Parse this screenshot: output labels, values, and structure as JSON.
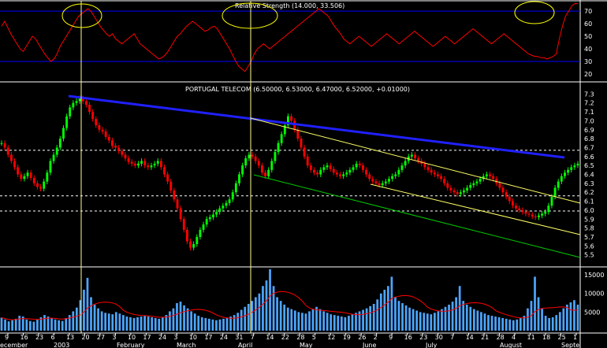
{
  "chart_data": [
    {
      "type": "line",
      "panel": "rsi",
      "title_overlap": "Relative Strength (14.000, 33.506)",
      "ylim": [
        15,
        77
      ],
      "y_ticks": [
        20,
        30,
        40,
        50,
        60,
        70
      ],
      "reference_lines": [
        30,
        70
      ],
      "series": [
        {
          "color": "#ff0000",
          "values": [
            58,
            62,
            57,
            52,
            48,
            44,
            40,
            38,
            42,
            46,
            50,
            48,
            44,
            40,
            36,
            33,
            30,
            32,
            36,
            42,
            46,
            50,
            54,
            58,
            62,
            66,
            68,
            70,
            72,
            70,
            66,
            62,
            58,
            55,
            52,
            50,
            52,
            48,
            46,
            44,
            46,
            48,
            50,
            52,
            48,
            44,
            42,
            40,
            38,
            36,
            34,
            32,
            33,
            35,
            38,
            42,
            46,
            50,
            52,
            55,
            58,
            60,
            62,
            60,
            58,
            56,
            54,
            55,
            57,
            58,
            56,
            52,
            48,
            44,
            40,
            35,
            30,
            26,
            24,
            22,
            26,
            30,
            36,
            40,
            42,
            44,
            42,
            40,
            42,
            44,
            46,
            48,
            50,
            52,
            54,
            56,
            58,
            60,
            62,
            64,
            66,
            68,
            70,
            72,
            70,
            68,
            66,
            62,
            58,
            55,
            52,
            48,
            46,
            44,
            46,
            48,
            50,
            48,
            46,
            44,
            42,
            44,
            46,
            48,
            50,
            52,
            50,
            48,
            46,
            44,
            46,
            48,
            50,
            52,
            54,
            52,
            50,
            48,
            46,
            44,
            42,
            44,
            46,
            48,
            50,
            48,
            46,
            44,
            46,
            48,
            50,
            52,
            54,
            56,
            54,
            52,
            50,
            48,
            46,
            44,
            46,
            48,
            50,
            52,
            50,
            48,
            46,
            44,
            42,
            40,
            38,
            36,
            35,
            34,
            34,
            33,
            33,
            32,
            33,
            34,
            36,
            48,
            58,
            66,
            70,
            74,
            76,
            76
          ]
        }
      ]
    },
    {
      "type": "candlestick",
      "panel": "price",
      "title": "PORTUGAL TELECOM (6.50000, 6.53000, 6.47000, 6.52000, +0.01000)",
      "ylim": [
        5.4,
        7.4
      ],
      "y_ticks": [
        "7.3",
        "7.2",
        "7.1",
        "7.0",
        "6.9",
        "6.8",
        "6.7",
        "6.6",
        "6.5",
        "6.4",
        "6.3",
        "6.2",
        "6.1",
        "6.0",
        "5.9",
        "5.8",
        "5.7",
        "5.6",
        "5.5"
      ],
      "horizontal_levels": [
        6.67,
        6.16,
        5.99
      ],
      "closes": [
        6.75,
        6.7,
        6.62,
        6.55,
        6.48,
        6.4,
        6.35,
        6.38,
        6.42,
        6.36,
        6.3,
        6.26,
        6.24,
        6.32,
        6.42,
        6.55,
        6.62,
        6.7,
        6.8,
        6.92,
        7.05,
        7.15,
        7.2,
        7.22,
        7.25,
        7.22,
        7.18,
        7.1,
        7.02,
        6.95,
        6.9,
        6.88,
        6.82,
        6.78,
        6.72,
        6.7,
        6.66,
        6.62,
        6.58,
        6.54,
        6.52,
        6.5,
        6.52,
        6.55,
        6.5,
        6.48,
        6.5,
        6.52,
        6.55,
        6.48,
        6.4,
        6.32,
        6.22,
        6.12,
        6.02,
        5.9,
        5.78,
        5.65,
        5.58,
        5.62,
        5.7,
        5.78,
        5.84,
        5.9,
        5.92,
        5.95,
        5.98,
        6.02,
        6.05,
        6.08,
        6.12,
        6.2,
        6.3,
        6.4,
        6.5,
        6.58,
        6.62,
        6.6,
        6.55,
        6.5,
        6.42,
        6.38,
        6.45,
        6.55,
        6.65,
        6.75,
        6.85,
        6.95,
        7.05,
        7.0,
        6.9,
        6.8,
        6.7,
        6.6,
        6.5,
        6.45,
        6.42,
        6.4,
        6.45,
        6.48,
        6.5,
        6.46,
        6.42,
        6.4,
        6.38,
        6.4,
        6.42,
        6.45,
        6.48,
        6.52,
        6.5,
        6.45,
        6.4,
        6.35,
        6.32,
        6.3,
        6.28,
        6.3,
        6.32,
        6.35,
        6.38,
        6.4,
        6.45,
        6.5,
        6.55,
        6.6,
        6.62,
        6.58,
        6.55,
        6.52,
        6.48,
        6.45,
        6.42,
        6.4,
        6.38,
        6.35,
        6.3,
        6.25,
        6.22,
        6.2,
        6.18,
        6.2,
        6.22,
        6.25,
        6.28,
        6.3,
        6.32,
        6.35,
        6.38,
        6.4,
        6.38,
        6.35,
        6.3,
        6.25,
        6.2,
        6.15,
        6.1,
        6.05,
        6.02,
        6.0,
        5.98,
        5.96,
        5.95,
        5.93,
        5.92,
        5.94,
        5.96,
        5.98,
        6.05,
        6.15,
        6.25,
        6.32,
        6.38,
        6.42,
        6.45,
        6.48,
        6.5,
        6.52
      ]
    },
    {
      "type": "bar",
      "panel": "volume",
      "ylim": [
        0,
        16500
      ],
      "y_ticks": [
        5000,
        10000,
        15000
      ],
      "x_labels": [
        "9",
        "16",
        "23",
        "6",
        "13",
        "20",
        "27",
        "3",
        "10",
        "17",
        "24",
        "3",
        "10",
        "17",
        "24",
        "31",
        "7",
        "14",
        "22",
        "28",
        "5",
        "12",
        "19",
        "26",
        "2",
        "9",
        "16",
        "23",
        "30",
        "7",
        "14",
        "21",
        "28",
        "4",
        "11",
        "18",
        "25",
        "1"
      ],
      "month_labels": [
        "ecember",
        "2003",
        "February",
        "March",
        "April",
        "May",
        "June",
        "July",
        "August",
        "Septe"
      ],
      "bar_color": "#4da6ff",
      "values": [
        3500,
        3000,
        2500,
        2800,
        3200,
        4000,
        3800,
        3000,
        2600,
        2400,
        3000,
        3600,
        4200,
        3800,
        3400,
        3000,
        2800,
        2600,
        3400,
        4200,
        5200,
        6200,
        8200,
        11000,
        14200,
        9000,
        7000,
        6000,
        5200,
        4800,
        4600,
        4400,
        5000,
        4600,
        4200,
        3800,
        3600,
        3400,
        3600,
        3800,
        4000,
        3800,
        3600,
        3400,
        3200,
        3600,
        4200,
        5200,
        6000,
        7400,
        7800,
        6800,
        6000,
        5200,
        4600,
        4000,
        3600,
        3400,
        3200,
        3000,
        2800,
        3000,
        3200,
        3400,
        3800,
        4200,
        4800,
        5600,
        6400,
        7200,
        8000,
        9000,
        10000,
        12000,
        13500,
        16500,
        12000,
        9000,
        8000,
        7000,
        6200,
        5800,
        5400,
        5000,
        4800,
        4600,
        5200,
        5800,
        6400,
        5800,
        5200,
        4800,
        4400,
        4200,
        4000,
        3800,
        3600,
        4000,
        4400,
        4800,
        5200,
        5600,
        6000,
        6600,
        7200,
        8400,
        10000,
        11000,
        12000,
        14500,
        9000,
        8000,
        7400,
        6800,
        6200,
        5800,
        5400,
        5000,
        4800,
        4600,
        4400,
        4800,
        5200,
        5800,
        6400,
        7000,
        7800,
        9000,
        12000,
        8000,
        7000,
        6400,
        5800,
        5400,
        5000,
        4600,
        4200,
        4000,
        3800,
        3600,
        3400,
        3200,
        3000,
        2800,
        3000,
        3400,
        4000,
        6000,
        8000,
        14500,
        9000,
        6000,
        4000,
        3400,
        3600,
        4200,
        5000,
        6000,
        7000,
        7600,
        8200,
        7000
      ]
    }
  ]
}
